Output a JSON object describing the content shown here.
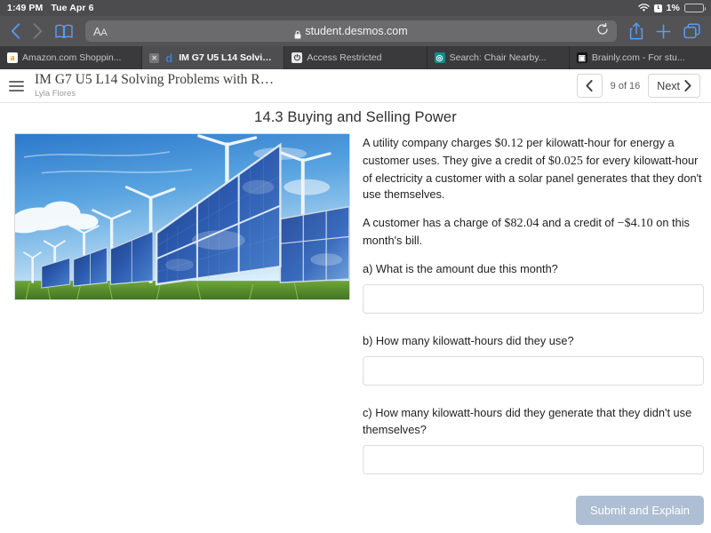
{
  "status_bar": {
    "time": "1:49 PM",
    "date": "Tue Apr 6",
    "wifi_icon": "wifi-icon",
    "alarm_icon": "alarm-clock-icon",
    "battery_percent": "1%",
    "battery_icon": "battery-icon"
  },
  "browser": {
    "back_icon": "chevron-left-icon",
    "forward_icon": "chevron-right-icon",
    "bookmarks_icon": "book-icon",
    "text_size_label": "AA",
    "lock_icon": "lock-icon",
    "url": "student.desmos.com",
    "reload_icon": "reload-icon",
    "share_icon": "share-icon",
    "new_tab_icon": "plus-icon",
    "tabs_overview_icon": "tabs-icon",
    "tabs": [
      {
        "title": "Amazon.com Shoppin...",
        "favicon": "amazon-icon",
        "glyph": "a",
        "active": false
      },
      {
        "title": "IM G7 U5 L14 Solving...",
        "favicon": "desmos-icon",
        "glyph": "d",
        "active": true,
        "close_icon": "close-icon"
      },
      {
        "title": "Access Restricted",
        "favicon": "power-icon",
        "glyph": "⏻",
        "active": false
      },
      {
        "title": "Search: Chair Nearby...",
        "favicon": "target-icon",
        "glyph": "◎",
        "active": false
      },
      {
        "title": "Brainly.com - For stu...",
        "favicon": "brainly-icon",
        "glyph": "▣",
        "active": false
      }
    ]
  },
  "activity_header": {
    "menu_icon": "hamburger-menu-icon",
    "title": "IM G7 U5 L14 Solving Problems with R…",
    "student_name": "Lyla Flores",
    "prev_icon": "chevron-left-icon",
    "page_count": "9 of 16",
    "next_label": "Next",
    "next_icon": "chevron-right-icon"
  },
  "slide": {
    "title": "14.3 Buying and Selling Power",
    "image_alt": "solar-panel-wind-farm-photo",
    "paragraph1": {
      "part1": "A utility company charges ",
      "math1": "$0.12",
      "part2": " per kilowatt-hour for energy a customer uses. They give a credit of ",
      "math2": "$0.025",
      "part3": " for every kilowatt-hour of electricity a customer with a solar panel generates that they don't use themselves."
    },
    "paragraph2": {
      "part1": "A customer has a charge of ",
      "math1": "$82.04",
      "part2": " and a credit of ",
      "math2": "−$4.10",
      "part3": " on this month's bill."
    },
    "questions": [
      {
        "label": "a) What is the amount due this month?",
        "value": "",
        "placeholder": ""
      },
      {
        "label": "b) How many kilowatt-hours did they use?",
        "value": "",
        "placeholder": ""
      },
      {
        "label": "c) How many kilowatt-hours did they generate that they didn't use themselves?",
        "value": "",
        "placeholder": ""
      }
    ],
    "submit_label": "Submit and Explain"
  },
  "colors": {
    "accent_blue": "#5b9bf8",
    "submit_button": "#aebfd4",
    "status_bar_bg": "#4c4c4e",
    "toolbar_bg": "#535355",
    "tabbar_bg": "#3a3a3c",
    "active_tab_bg": "#4e4e50",
    "battery_red": "#ff5b53"
  }
}
